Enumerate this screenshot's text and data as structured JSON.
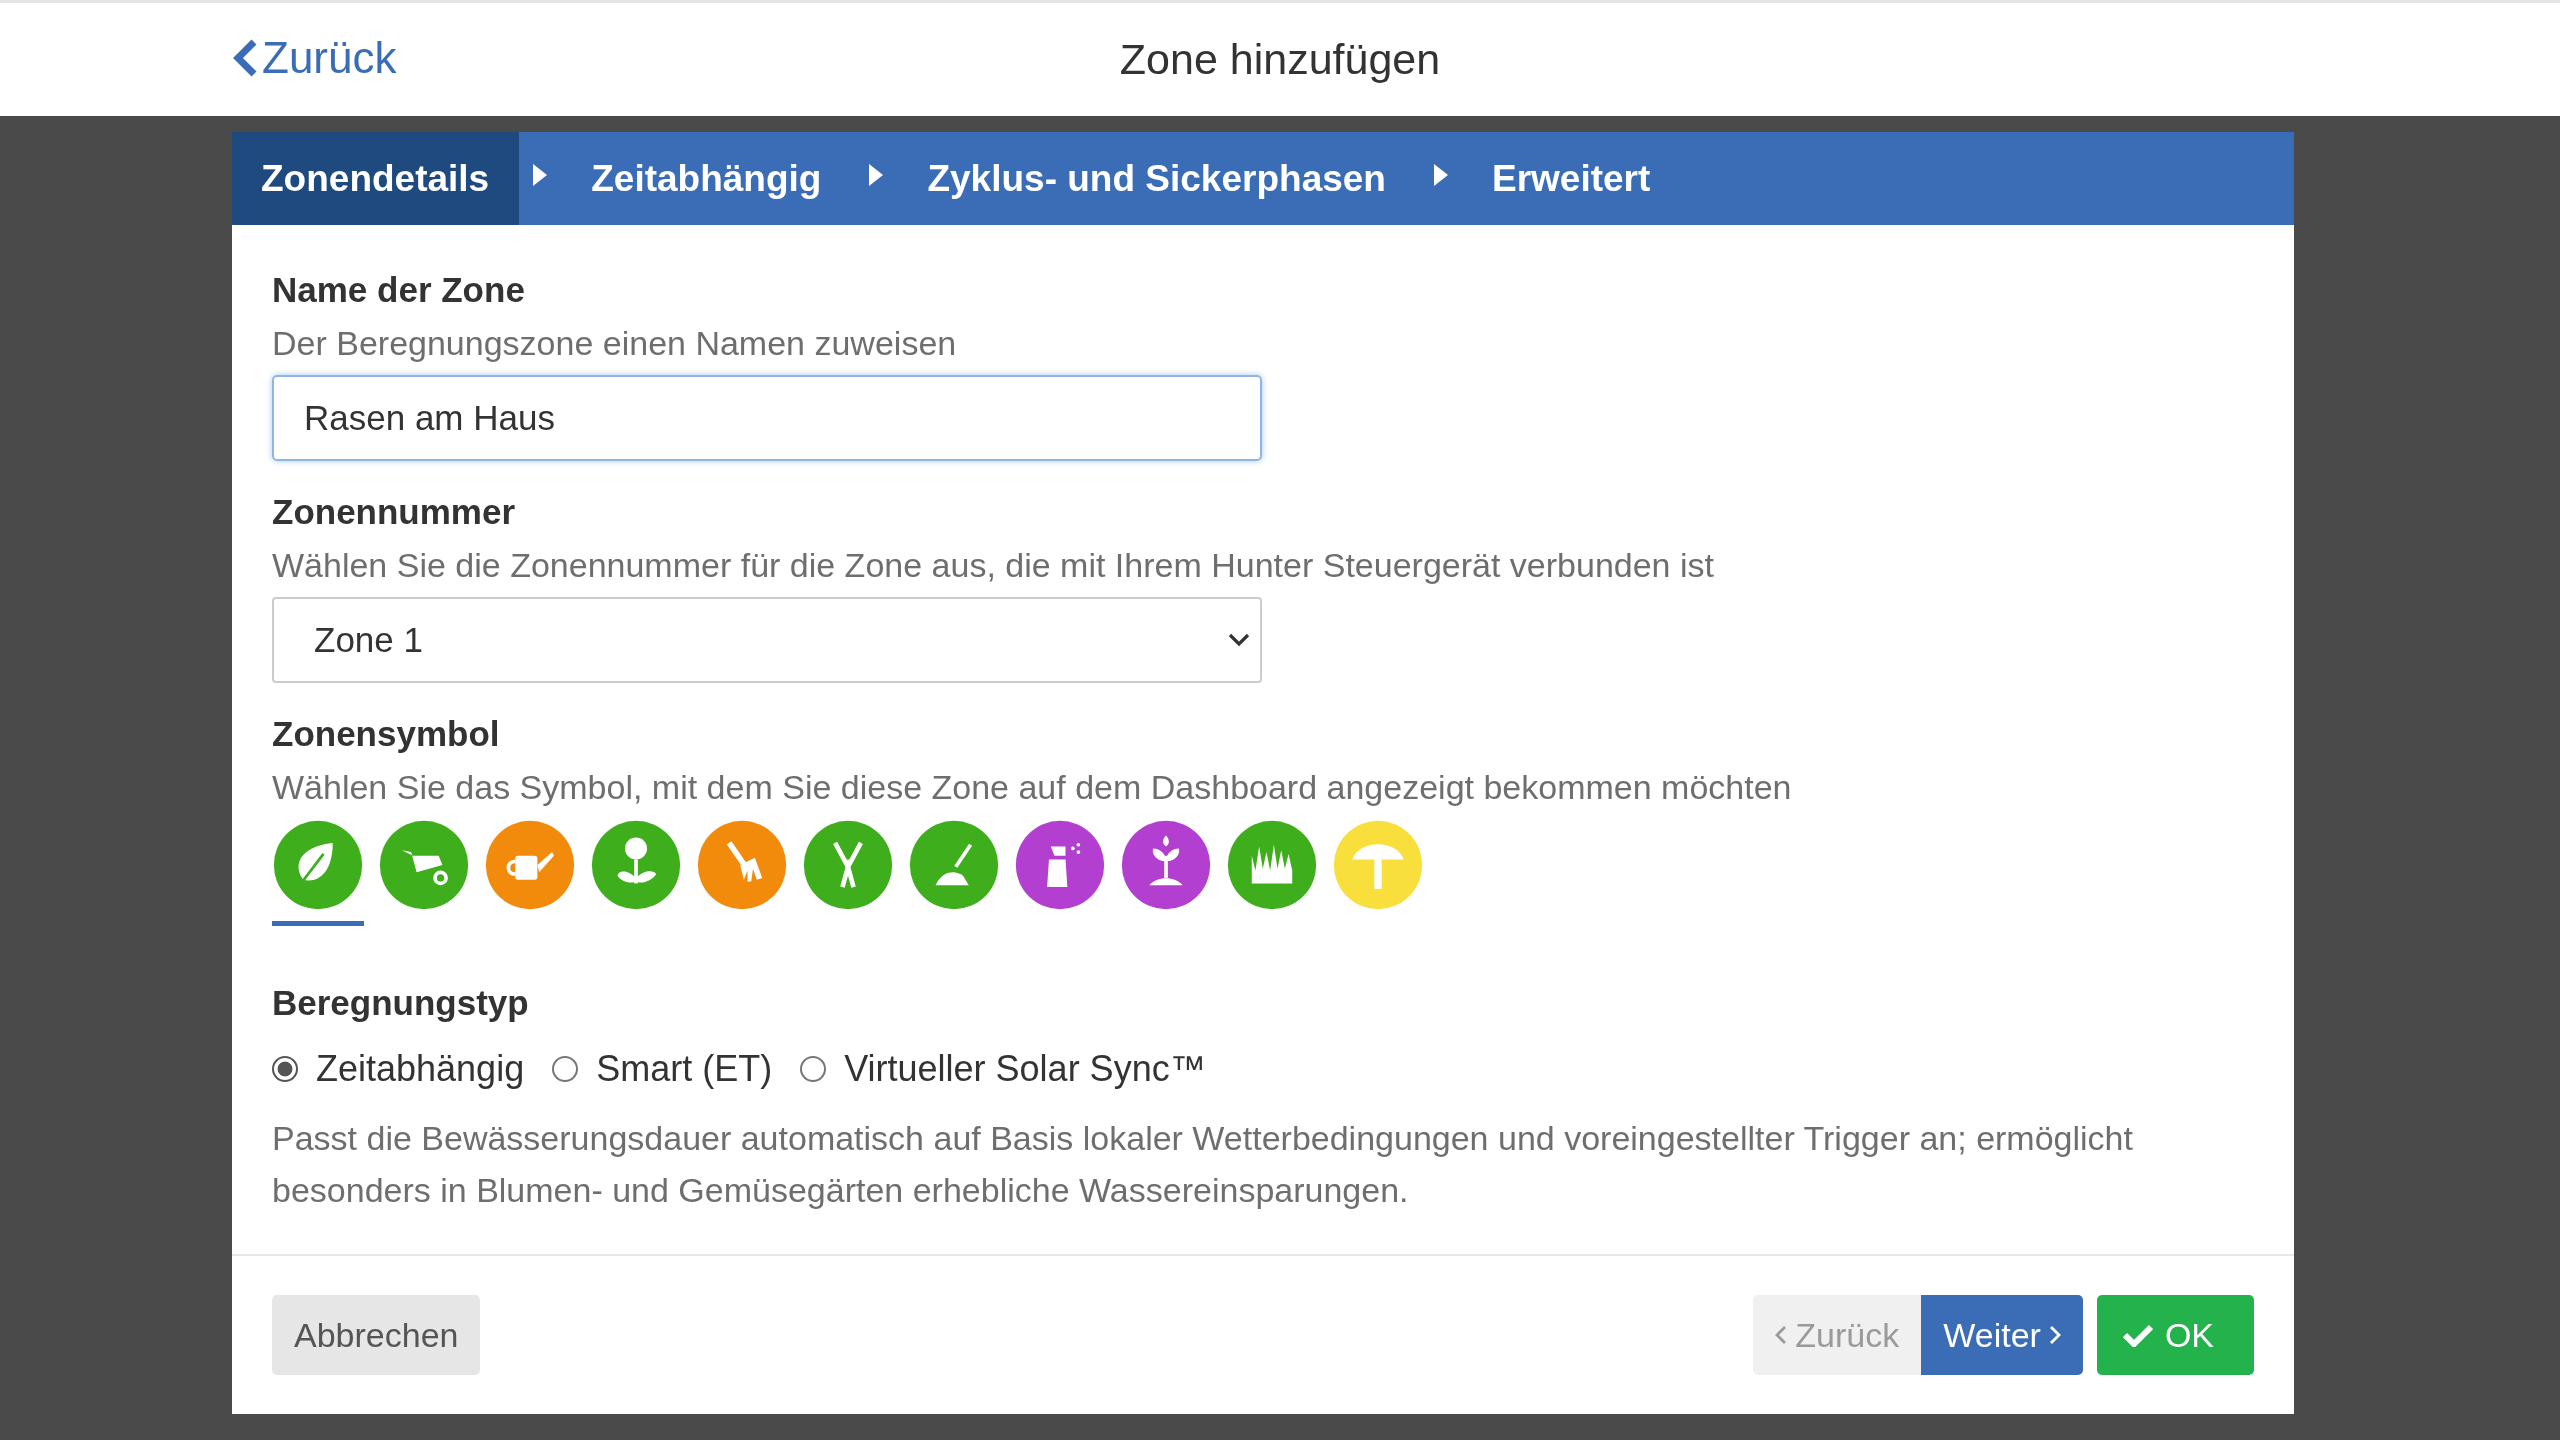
{
  "header": {
    "back": "Zurück",
    "title": "Zone hinzufügen"
  },
  "tabs": [
    {
      "label": "Zonendetails",
      "selected": true
    },
    {
      "label": "Zeitabhängig",
      "selected": false
    },
    {
      "label": "Zyklus- und Sickerphasen",
      "selected": false
    },
    {
      "label": "Erweitert",
      "selected": false
    }
  ],
  "name_section": {
    "heading": "Name der Zone",
    "hint": "Der Beregnungszone einen Namen zuweisen",
    "value": "Rasen am Haus"
  },
  "number_section": {
    "heading": "Zonennummer",
    "hint": "Wählen Sie die Zonennummer für die Zone aus, die mit Ihrem Hunter Steuergerät verbunden ist",
    "value": "Zone 1"
  },
  "symbol_section": {
    "heading": "Zonensymbol",
    "hint": "Wählen Sie das Symbol, mit dem Sie diese Zone auf dem Dashboard angezeigt bekommen möchten",
    "icons": [
      {
        "kind": "leaf",
        "color": "#3fae1c",
        "selected": true
      },
      {
        "kind": "wheelbarrow",
        "color": "#3fae1c",
        "selected": false
      },
      {
        "kind": "watering-can",
        "color": "#f28a0c",
        "selected": false
      },
      {
        "kind": "flower",
        "color": "#3fae1c",
        "selected": false
      },
      {
        "kind": "rake",
        "color": "#f28a0c",
        "selected": false
      },
      {
        "kind": "shears",
        "color": "#3fae1c",
        "selected": false
      },
      {
        "kind": "shovel",
        "color": "#3fae1c",
        "selected": false
      },
      {
        "kind": "sprayer",
        "color": "#b23fd0",
        "selected": false
      },
      {
        "kind": "sprout",
        "color": "#b23fd0",
        "selected": false
      },
      {
        "kind": "grass",
        "color": "#3fae1c",
        "selected": false
      },
      {
        "kind": "umbrella",
        "color": "#f9df3c",
        "selected": false
      }
    ]
  },
  "type_section": {
    "heading": "Beregnungstyp",
    "options": [
      {
        "label": "Zeitabhängig",
        "selected": true
      },
      {
        "label": "Smart (ET)",
        "selected": false
      },
      {
        "label": "Virtueller Solar Sync™",
        "selected": false
      }
    ],
    "description": "Passt die Bewässerungsdauer automatisch auf Basis lokaler Wetterbedingungen und voreingestellter Trigger an; ermöglicht besonders in Blumen- und Gemüsegärten erhebliche Wassereinsparungen."
  },
  "footer": {
    "cancel": "Abbrechen",
    "back": {
      "label": "Zurück",
      "disabled": true
    },
    "next": "Weiter",
    "ok": "OK"
  }
}
